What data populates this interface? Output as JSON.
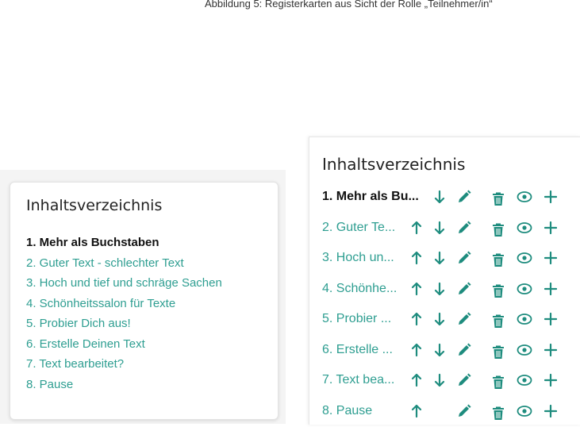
{
  "caption": "Abbildung 5: Registerkarten aus Sicht der Rolle „Teilnehmer/in“",
  "left_panel": {
    "title": "Inhaltsverzeichnis",
    "items": [
      {
        "label": "1. Mehr als Buchstaben",
        "active": true
      },
      {
        "label": "2. Guter Text - schlechter Text"
      },
      {
        "label": "3. Hoch und tief und schräge Sachen"
      },
      {
        "label": "4. Schönheitssalon für Texte"
      },
      {
        "label": "5. Probier Dich aus!"
      },
      {
        "label": "6. Erstelle Deinen Text"
      },
      {
        "label": "7. Text bearbeitet?"
      },
      {
        "label": "8. Pause"
      }
    ]
  },
  "right_panel": {
    "title": "Inhaltsverzeichnis",
    "items": [
      {
        "label": "1. Mehr als Bu...",
        "active": true,
        "up": false,
        "down": true
      },
      {
        "label": "2. Guter Te...",
        "up": true,
        "down": true
      },
      {
        "label": "3. Hoch un...",
        "up": true,
        "down": true
      },
      {
        "label": "4. Schönhe...",
        "up": true,
        "down": true
      },
      {
        "label": "5. Probier ...",
        "up": true,
        "down": true
      },
      {
        "label": "6. Erstelle ...",
        "up": true,
        "down": true
      },
      {
        "label": "7. Text bea...",
        "up": true,
        "down": true
      },
      {
        "label": "8. Pause",
        "up": true,
        "down": false
      }
    ],
    "icons": [
      "arrow-up-icon",
      "arrow-down-icon",
      "pencil-icon",
      "trash-icon",
      "eye-icon",
      "plus-icon"
    ]
  },
  "colors": {
    "accent": "#2e9e91",
    "icon": "#1e8c7e",
    "active_text": "#111111"
  }
}
